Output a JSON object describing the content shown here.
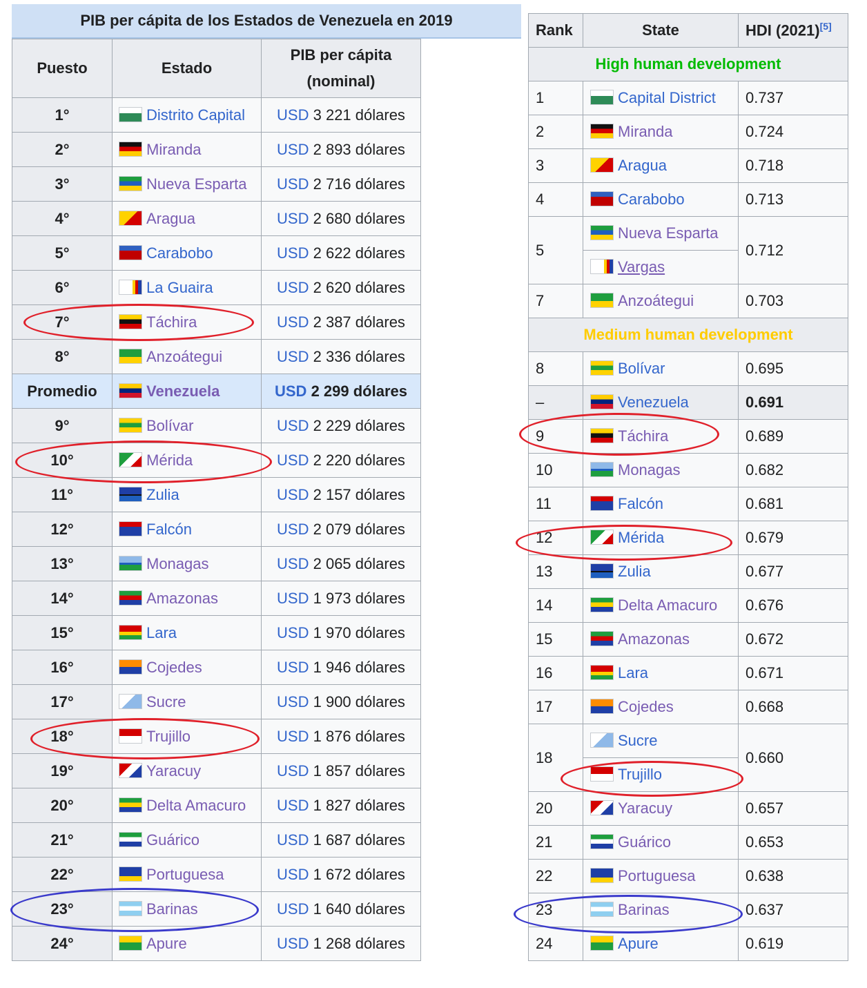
{
  "left_table": {
    "caption": "PIB per cápita de los Estados de Venezuela en 2019",
    "headers": [
      "Puesto",
      "Estado",
      "PIB per cápita (nominal)"
    ],
    "currency": "USD",
    "rows": [
      {
        "rank": "1°",
        "state": "Distrito Capital",
        "gdp": "3 221 dólares",
        "flag": "f-capital"
      },
      {
        "rank": "2°",
        "state": "Miranda",
        "gdp": "2 893 dólares",
        "flag": "f-miranda"
      },
      {
        "rank": "3°",
        "state": "Nueva Esparta",
        "gdp": "2 716 dólares",
        "flag": "f-nueva"
      },
      {
        "rank": "4°",
        "state": "Aragua",
        "gdp": "2 680 dólares",
        "flag": "f-aragua"
      },
      {
        "rank": "5°",
        "state": "Carabobo",
        "gdp": "2 622 dólares",
        "flag": "f-carabobo"
      },
      {
        "rank": "6°",
        "state": "La Guaira",
        "gdp": "2 620 dólares",
        "flag": "f-guaira"
      },
      {
        "rank": "7°",
        "state": "Táchira",
        "gdp": "2 387 dólares",
        "flag": "f-tachira"
      },
      {
        "rank": "8°",
        "state": "Anzoátegui",
        "gdp": "2 336 dólares",
        "flag": "f-anzo"
      },
      {
        "rank": "Promedio",
        "state": "Venezuela",
        "gdp": "2 299 dólares",
        "flag": "f-venezuela",
        "avg": true
      },
      {
        "rank": "9°",
        "state": "Bolívar",
        "gdp": "2 229 dólares",
        "flag": "f-bolivar"
      },
      {
        "rank": "10°",
        "state": "Mérida",
        "gdp": "2 220 dólares",
        "flag": "f-merida"
      },
      {
        "rank": "11°",
        "state": "Zulia",
        "gdp": "2 157 dólares",
        "flag": "f-zulia"
      },
      {
        "rank": "12°",
        "state": "Falcón",
        "gdp": "2 079 dólares",
        "flag": "f-falcon"
      },
      {
        "rank": "13°",
        "state": "Monagas",
        "gdp": "2 065 dólares",
        "flag": "f-monagas"
      },
      {
        "rank": "14°",
        "state": "Amazonas",
        "gdp": "1 973 dólares",
        "flag": "f-amazonas"
      },
      {
        "rank": "15°",
        "state": "Lara",
        "gdp": "1 970 dólares",
        "flag": "f-lara"
      },
      {
        "rank": "16°",
        "state": "Cojedes",
        "gdp": "1 946 dólares",
        "flag": "f-cojedes"
      },
      {
        "rank": "17°",
        "state": "Sucre",
        "gdp": "1 900 dólares",
        "flag": "f-sucre"
      },
      {
        "rank": "18°",
        "state": "Trujillo",
        "gdp": "1 876 dólares",
        "flag": "f-trujillo"
      },
      {
        "rank": "19°",
        "state": "Yaracuy",
        "gdp": "1 857 dólares",
        "flag": "f-yaracuy"
      },
      {
        "rank": "20°",
        "state": "Delta Amacuro",
        "gdp": "1 827 dólares",
        "flag": "f-delta"
      },
      {
        "rank": "21°",
        "state": "Guárico",
        "gdp": "1 687 dólares",
        "flag": "f-guarico"
      },
      {
        "rank": "22°",
        "state": "Portuguesa",
        "gdp": "1 672 dólares",
        "flag": "f-portuguesa"
      },
      {
        "rank": "23°",
        "state": "Barinas",
        "gdp": "1 640 dólares",
        "flag": "f-barinas"
      },
      {
        "rank": "24°",
        "state": "Apure",
        "gdp": "1 268 dólares",
        "flag": "f-apure"
      }
    ]
  },
  "right_table": {
    "headers": {
      "rank": "Rank",
      "state": "State",
      "hdi": "HDI (2021)",
      "ref": "[5]"
    },
    "categories": {
      "high": {
        "label": "High human development",
        "color": "#00bb00"
      },
      "medium": {
        "label": "Medium human development",
        "color": "#ffcc00"
      }
    },
    "rows": [
      {
        "type": "cat",
        "key": "high"
      },
      {
        "rank": "1",
        "state": "Capital District",
        "hdi": "0.737",
        "flag": "f-capital"
      },
      {
        "rank": "2",
        "state": "Miranda",
        "hdi": "0.724",
        "flag": "f-miranda"
      },
      {
        "rank": "3",
        "state": "Aragua",
        "hdi": "0.718",
        "flag": "f-aragua"
      },
      {
        "rank": "4",
        "state": "Carabobo",
        "hdi": "0.713",
        "flag": "f-carabobo"
      },
      {
        "rank": "5",
        "state": "Nueva Esparta",
        "hdi": "0.712",
        "flag": "f-nueva",
        "span": 2
      },
      {
        "state": "Vargas",
        "flag": "f-vargas",
        "sub": true,
        "underline": true
      },
      {
        "rank": "7",
        "state": "Anzoátegui",
        "hdi": "0.703",
        "flag": "f-anzo"
      },
      {
        "type": "cat",
        "key": "medium"
      },
      {
        "rank": "8",
        "state": "Bolívar",
        "hdi": "0.695",
        "flag": "f-bolivar"
      },
      {
        "rank": "–",
        "state": "Venezuela",
        "hdi": "0.691",
        "flag": "f-venezuela",
        "avg": true
      },
      {
        "rank": "9",
        "state": "Táchira",
        "hdi": "0.689",
        "flag": "f-tachira"
      },
      {
        "rank": "10",
        "state": "Monagas",
        "hdi": "0.682",
        "flag": "f-monagas"
      },
      {
        "rank": "11",
        "state": "Falcón",
        "hdi": "0.681",
        "flag": "f-falcon"
      },
      {
        "rank": "12",
        "state": "Mérida",
        "hdi": "0.679",
        "flag": "f-merida"
      },
      {
        "rank": "13",
        "state": "Zulia",
        "hdi": "0.677",
        "flag": "f-zulia"
      },
      {
        "rank": "14",
        "state": "Delta Amacuro",
        "hdi": "0.676",
        "flag": "f-delta"
      },
      {
        "rank": "15",
        "state": "Amazonas",
        "hdi": "0.672",
        "flag": "f-amazonas"
      },
      {
        "rank": "16",
        "state": "Lara",
        "hdi": "0.671",
        "flag": "f-lara"
      },
      {
        "rank": "17",
        "state": "Cojedes",
        "hdi": "0.668",
        "flag": "f-cojedes"
      },
      {
        "rank": "18",
        "state": "Sucre",
        "hdi": "0.660",
        "flag": "f-sucre",
        "span": 2
      },
      {
        "state": "Trujillo",
        "flag": "f-trujillo",
        "sub": true
      },
      {
        "rank": "20",
        "state": "Yaracuy",
        "hdi": "0.657",
        "flag": "f-yaracuy"
      },
      {
        "rank": "21",
        "state": "Guárico",
        "hdi": "0.653",
        "flag": "f-guarico"
      },
      {
        "rank": "22",
        "state": "Portuguesa",
        "hdi": "0.638",
        "flag": "f-portuguesa"
      },
      {
        "rank": "23",
        "state": "Barinas",
        "hdi": "0.637",
        "flag": "f-barinas"
      },
      {
        "rank": "24",
        "state": "Apure",
        "hdi": "0.619",
        "flag": "f-apure"
      }
    ]
  }
}
